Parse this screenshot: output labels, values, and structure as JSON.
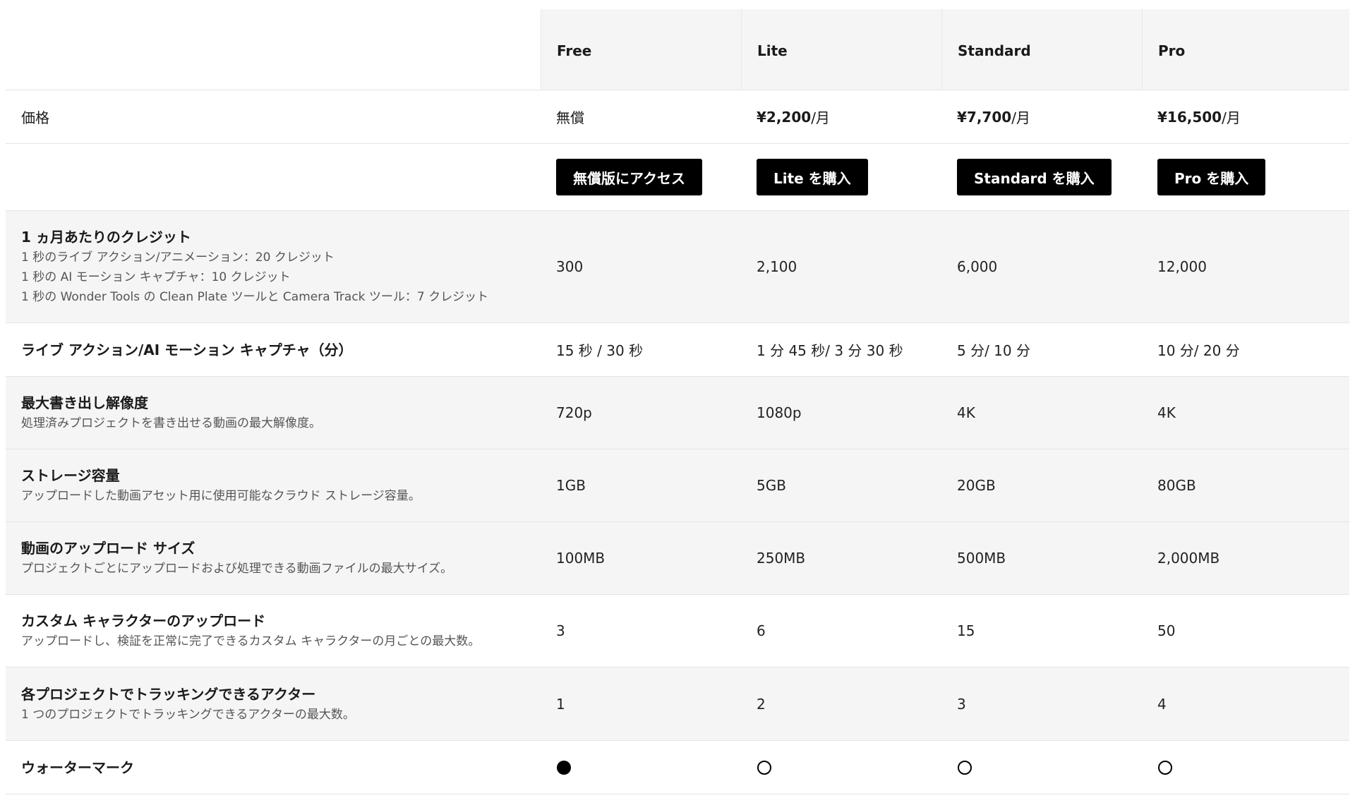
{
  "plans": [
    {
      "name": "Free",
      "price": "無償",
      "price_suffix": "",
      "button": "無償版にアクセス"
    },
    {
      "name": "Lite",
      "price": "¥2,200",
      "price_suffix": "/月",
      "button": "Lite を購入"
    },
    {
      "name": "Standard",
      "price": "¥7,700",
      "price_suffix": "/月",
      "button": "Standard を購入"
    },
    {
      "name": "Pro",
      "price": "¥16,500",
      "price_suffix": "/月",
      "button": "Pro を購入"
    }
  ],
  "price_label": "価格",
  "features": [
    {
      "title": "1 ヵ月あたりのクレジット",
      "desc": [
        "1 秒のライブ アクション/アニメーション：20 クレジット",
        "1 秒の AI モーション キャプチャ：10 クレジット",
        "1 秒の Wonder Tools の Clean Plate ツールと Camera Track ツール：7 クレジット"
      ],
      "values": [
        "300",
        "2,100",
        "6,000",
        "12,000"
      ]
    },
    {
      "title": "ライブ アクション/AI モーション キャプチャ（分）",
      "desc": [],
      "values": [
        "15 秒 / 30 秒",
        "1 分 45 秒/ 3 分 30 秒",
        "5 分/ 10 分",
        "10 分/ 20 分"
      ]
    },
    {
      "title": "最大書き出し解像度",
      "desc": [
        "処理済みプロジェクトを書き出せる動画の最大解像度。"
      ],
      "values": [
        "720p",
        "1080p",
        "4K",
        "4K"
      ]
    },
    {
      "title": "ストレージ容量",
      "desc": [
        "アップロードした動画アセット用に使用可能なクラウド ストレージ容量。"
      ],
      "values": [
        "1GB",
        "5GB",
        "20GB",
        "80GB"
      ]
    },
    {
      "title": "動画のアップロード サイズ",
      "desc": [
        "プロジェクトごとにアップロードおよび処理できる動画ファイルの最大サイズ。"
      ],
      "values": [
        "100MB",
        "250MB",
        "500MB",
        "2,000MB"
      ]
    },
    {
      "title": "カスタム キャラクターのアップロード",
      "desc": [
        "アップロードし、検証を正常に完了できるカスタム キャラクターの月ごとの最大数。"
      ],
      "values": [
        "3",
        "6",
        "15",
        "50"
      ]
    },
    {
      "title": "各プロジェクトでトラッキングできるアクター",
      "desc": [
        "1 つのプロジェクトでトラッキングできるアクターの最大数。"
      ],
      "values": [
        "1",
        "2",
        "3",
        "4"
      ]
    },
    {
      "title": "ウォーターマーク",
      "desc": [],
      "watermark": [
        "filled-circle-icon",
        "empty-circle-icon",
        "empty-circle-icon",
        "empty-circle-icon"
      ]
    }
  ]
}
